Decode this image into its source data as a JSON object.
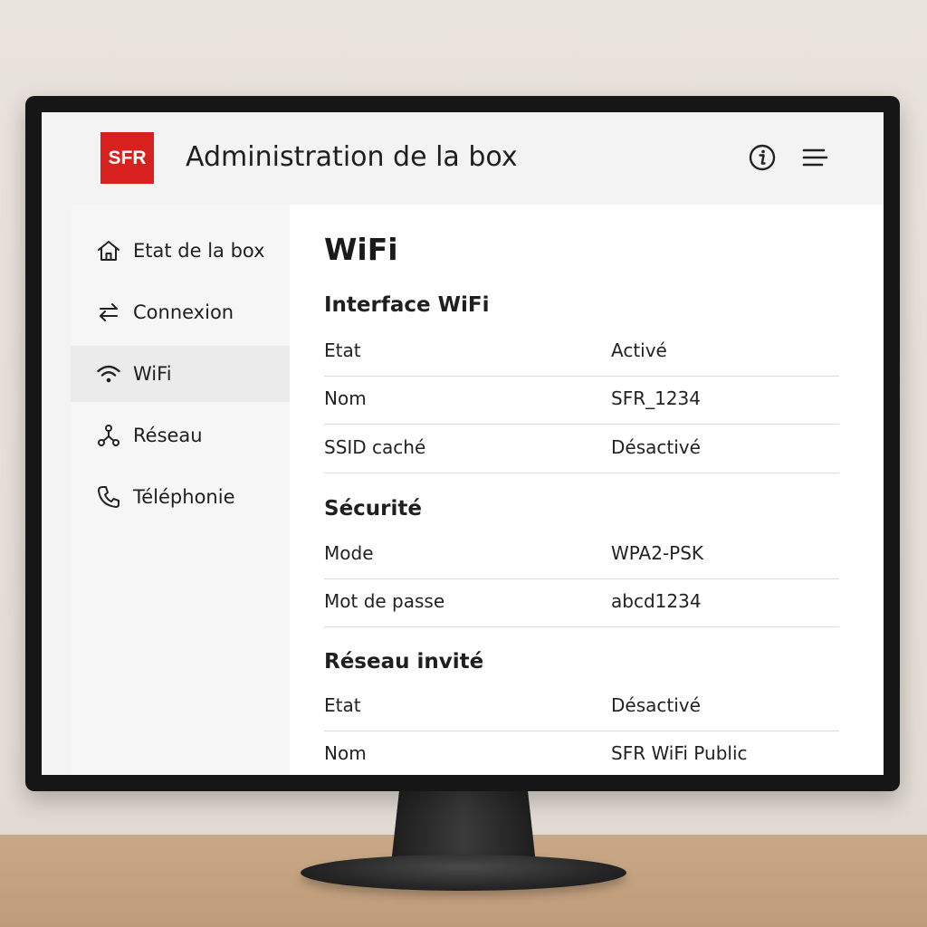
{
  "header": {
    "logo_text": "SFR",
    "title": "Administration de la box",
    "info_icon": "info-icon",
    "menu_icon": "menu-icon",
    "brand_color": "#d8201e"
  },
  "sidebar": {
    "items": [
      {
        "label": "Etat de la box",
        "icon": "home-icon",
        "active": false
      },
      {
        "label": "Connexion",
        "icon": "arrows-icon",
        "active": false
      },
      {
        "label": "WiFi",
        "icon": "wifi-icon",
        "active": true
      },
      {
        "label": "Réseau",
        "icon": "network-icon",
        "active": false
      },
      {
        "label": "Téléphonie",
        "icon": "phone-icon",
        "active": false
      }
    ]
  },
  "main": {
    "title": "WiFi",
    "sections": [
      {
        "title": "Interface WiFi",
        "rows": [
          {
            "label": "Etat",
            "value": "Activé"
          },
          {
            "label": "Nom",
            "value": "SFR_1234"
          },
          {
            "label": "SSID caché",
            "value": "Désactivé"
          }
        ]
      },
      {
        "title": "Sécurité",
        "rows": [
          {
            "label": "Mode",
            "value": "WPA2-PSK"
          },
          {
            "label": "Mot de passe",
            "value": "abcd1234"
          }
        ]
      },
      {
        "title": "Réseau invité",
        "rows": [
          {
            "label": "Etat",
            "value": "Désactivé"
          },
          {
            "label": "Nom",
            "value": "SFR WiFi Public"
          }
        ]
      }
    ]
  }
}
